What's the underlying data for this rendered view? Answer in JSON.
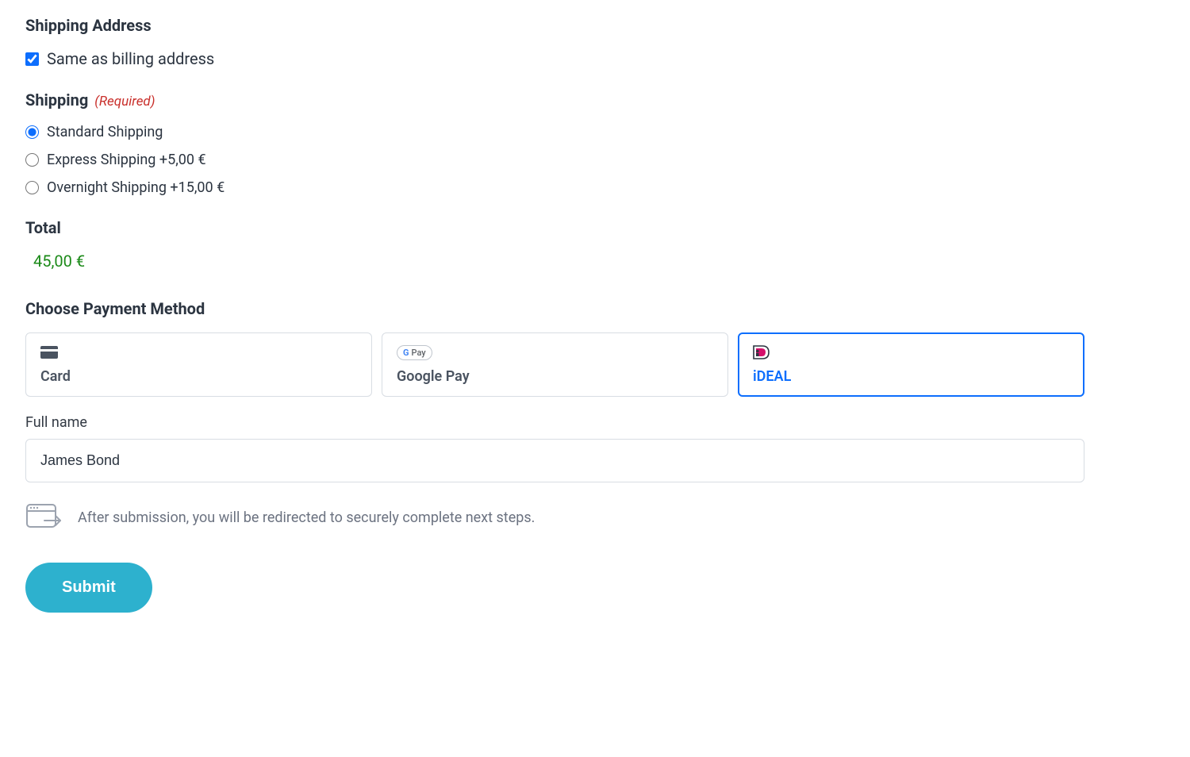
{
  "shipping_address": {
    "heading": "Shipping Address",
    "same_as_billing_label": "Same as billing address",
    "same_as_billing_checked": true
  },
  "shipping_method": {
    "heading": "Shipping",
    "required_label": "(Required)",
    "options": [
      {
        "label": "Standard Shipping",
        "selected": true
      },
      {
        "label": "Express Shipping +5,00 €",
        "selected": false
      },
      {
        "label": "Overnight Shipping +15,00 €",
        "selected": false
      }
    ]
  },
  "total": {
    "heading": "Total",
    "value": "45,00 €"
  },
  "payment": {
    "heading": "Choose Payment Method",
    "methods": [
      {
        "label": "Card",
        "icon": "card-icon",
        "selected": false
      },
      {
        "label": "Google Pay",
        "icon": "gpay-icon",
        "selected": false
      },
      {
        "label": "iDEAL",
        "icon": "ideal-icon",
        "selected": true
      }
    ],
    "full_name_label": "Full name",
    "full_name_value": "James Bond",
    "redirect_notice": "After submission, you will be redirected to securely complete next steps."
  },
  "submit_label": "Submit",
  "colors": {
    "accent": "#0d6efd",
    "required": "#c9302c",
    "total": "#1a8917",
    "submit": "#2db1ce"
  }
}
